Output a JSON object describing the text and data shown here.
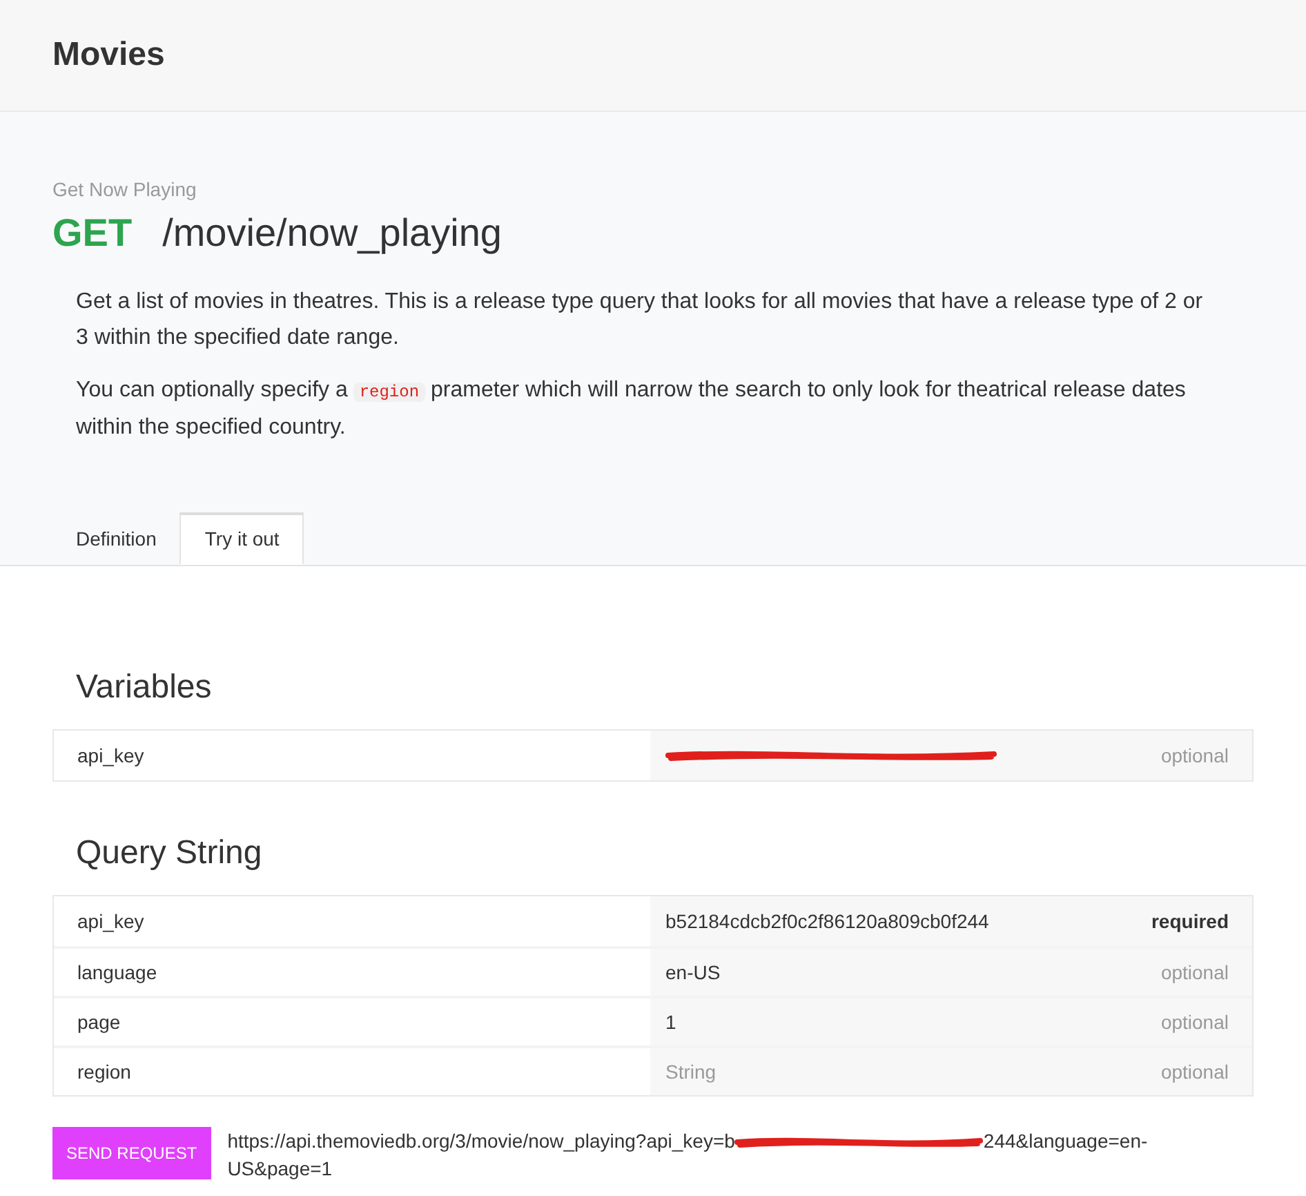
{
  "header": {
    "title": "Movies"
  },
  "endpoint": {
    "summary": "Get Now Playing",
    "method": "GET",
    "path": "/movie/now_playing",
    "paragraphs": [
      [
        {
          "kind": "text",
          "text": "Get a list of movies in theatres. This is a release type query that looks for all movies that have a release type of 2 or 3 within the specified date range."
        }
      ],
      [
        {
          "kind": "text",
          "text": "You can optionally specify a "
        },
        {
          "kind": "code",
          "text": "region"
        },
        {
          "kind": "text",
          "text": " prameter which will narrow the search to only look for theatrical release dates within the specified country."
        }
      ]
    ]
  },
  "tabs": [
    {
      "label": "Definition",
      "selected": false
    },
    {
      "label": "Try it out",
      "selected": true
    }
  ],
  "sections": [
    {
      "title": "Variables",
      "rows": [
        {
          "name": "api_key",
          "kind": "redacted",
          "requirement": "optional",
          "required": false
        }
      ]
    },
    {
      "title": "Query String",
      "rows": [
        {
          "name": "api_key",
          "kind": "value",
          "value": "b52184cdcb2f0c2f86120a809cb0f244",
          "requirement": "required",
          "required": true
        },
        {
          "name": "language",
          "kind": "value",
          "value": "en-US",
          "requirement": "optional",
          "required": false
        },
        {
          "name": "page",
          "kind": "value",
          "value": "1",
          "requirement": "optional",
          "required": false
        },
        {
          "name": "region",
          "kind": "empty",
          "placeholder": "String",
          "requirement": "optional",
          "required": false
        }
      ]
    }
  ],
  "request": {
    "button": "SEND REQUEST",
    "url_start": "https://api.themoviedb.org/3/movie/now_playing?api_key=b",
    "url_end": "244&language=en-US&page=1"
  }
}
